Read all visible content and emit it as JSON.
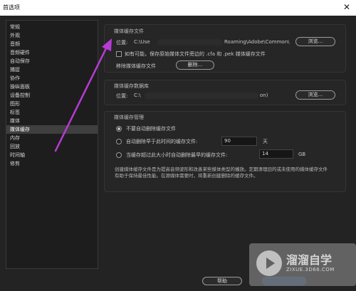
{
  "window": {
    "title": "首选项",
    "close_glyph": "✕"
  },
  "sidebar": {
    "items": [
      {
        "label": "常规"
      },
      {
        "label": "外观"
      },
      {
        "label": "音频"
      },
      {
        "label": "音频硬件"
      },
      {
        "label": "自动保存"
      },
      {
        "label": "捕捉"
      },
      {
        "label": "协作"
      },
      {
        "label": "操纵面板"
      },
      {
        "label": "设备控制"
      },
      {
        "label": "图形"
      },
      {
        "label": "标签"
      },
      {
        "label": "媒体"
      },
      {
        "label": "媒体缓存",
        "selected": true
      },
      {
        "label": "内存"
      },
      {
        "label": "回放"
      },
      {
        "label": "时间轴"
      },
      {
        "label": "修剪"
      }
    ]
  },
  "media_cache_files": {
    "title": "媒体缓存文件",
    "location_label": "位置:",
    "location_prefix": "C:\\Use",
    "location_suffix": "Roaming\\Adobe\\Common\\",
    "browse_label": "浏览...",
    "save_beside_label": "如有可能，保存原始媒体文件旁边的 .cfa 和 .pek 媒体缓存文件",
    "save_beside_checked": false,
    "remove_label": "移除媒体缓存文件",
    "delete_button": "删除..."
  },
  "media_cache_db": {
    "title": "媒体缓存数据库",
    "location_label": "位置:",
    "location_prefix": "C:\\",
    "location_suffix": "on)",
    "browse_label": "浏览..."
  },
  "cache_management": {
    "title": "媒体缓存管理",
    "options": [
      {
        "label": "不要自动删除缓存文件",
        "checked": true
      },
      {
        "label": "自动删除早于此时间的缓存文件:",
        "value": "90",
        "unit": "天",
        "checked": false
      },
      {
        "label": "当缓存超过此大小时自动删除最早的缓存文件:",
        "value": "14",
        "unit": "GB",
        "checked": false
      }
    ],
    "description": "创建媒体缓存文件是为提高音频波形和改善某些媒体类型的播放。定期清理旧的或未使用的媒体缓存文件有助于保持最佳性能。在源媒体需要时，将重新创建删除的缓存文件。"
  },
  "footer": {
    "help_label": "帮助"
  },
  "annotation": {
    "arrow_color": "#b83bd6"
  },
  "watermark": {
    "title": "溜溜自学",
    "url": "ZIXUE.3D66.COM"
  }
}
